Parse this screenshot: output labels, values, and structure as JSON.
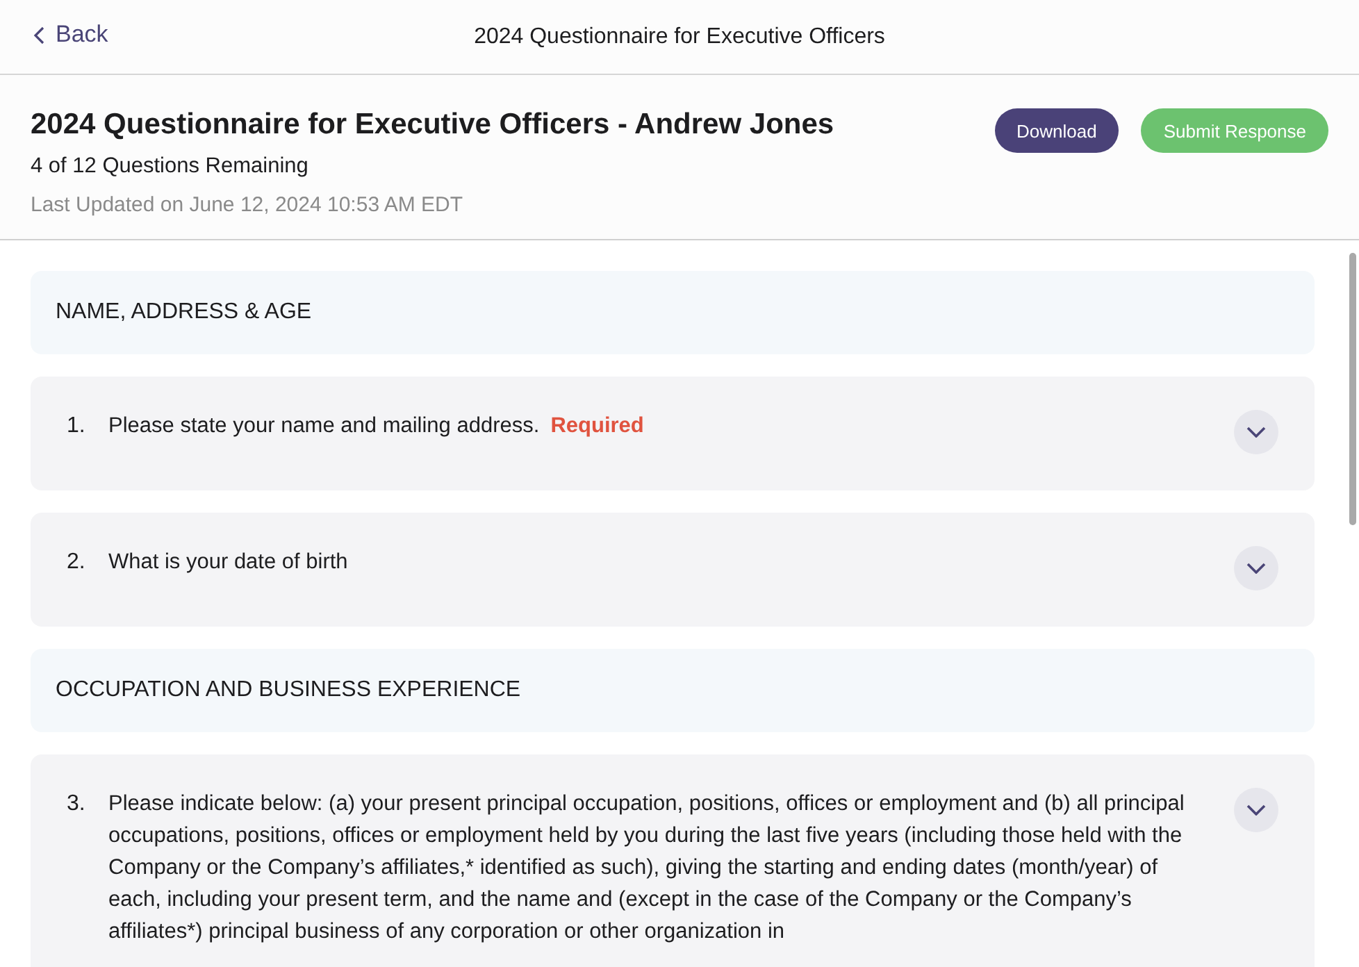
{
  "nav": {
    "back": "Back",
    "title": "2024 Questionnaire for Executive Officers"
  },
  "header": {
    "title": "2024 Questionnaire for Executive Officers - Andrew Jones",
    "remaining": "4 of 12 Questions Remaining",
    "updated": "Last Updated on June 12, 2024 10:53 AM EDT",
    "buttons": [
      "Download",
      "Submit Response"
    ]
  },
  "items": [
    {
      "kind": "section",
      "title": "NAME, ADDRESS & AGE"
    },
    {
      "kind": "question",
      "number": "1.",
      "text": "Please state your name and mailing address.",
      "required": "Required"
    },
    {
      "kind": "question",
      "number": "2.",
      "text": "What is your date of birth"
    },
    {
      "kind": "section",
      "title": "OCCUPATION AND BUSINESS EXPERIENCE"
    },
    {
      "kind": "question",
      "number": "3.",
      "text": "Please indicate below: (a) your present principal occupation, positions, offices or employment and (b) all principal occupations, positions, offices or employment held by you during the last five years (including those held with the Company or the Company’s affiliates,* identified as such), giving the starting and ending dates (month/year) of each, including your present term, and the name and (except in the case of the Company or the Company’s affiliates*) principal business of any corporation or other organization in"
    }
  ]
}
